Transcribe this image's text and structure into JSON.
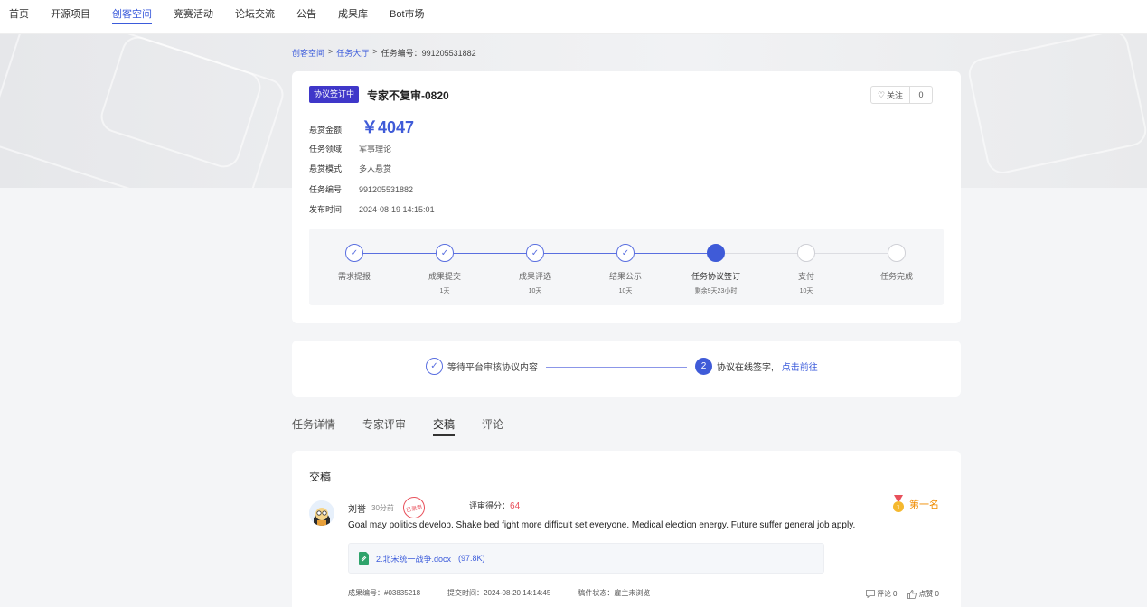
{
  "nav": {
    "items": [
      "首页",
      "开源项目",
      "创客空间",
      "竞赛活动",
      "论坛交流",
      "公告",
      "成果库",
      "Bot市场"
    ],
    "active_index": 2
  },
  "breadcrumb": {
    "items": [
      "创客空间",
      "任务大厅"
    ],
    "current_label": "任务编号：",
    "current_value": "991205531882",
    "separator": ">"
  },
  "task": {
    "status_tag": "协议签订中",
    "title": "专家不复审-0820",
    "follow_label": "关注",
    "follow_count": "0",
    "reward_label": "悬赏金额",
    "reward_value": "￥4047",
    "fields": [
      {
        "label": "任务领域",
        "value": "军事理论"
      },
      {
        "label": "悬赏模式",
        "value": "多人悬赏"
      },
      {
        "label": "任务编号",
        "value": "991205531882"
      },
      {
        "label": "发布时间",
        "value": "2024-08-19 14:15:01"
      }
    ]
  },
  "progress": {
    "steps": [
      {
        "label": "需求提报",
        "sub": "",
        "state": "done"
      },
      {
        "label": "成果提交",
        "sub": "1天",
        "state": "done"
      },
      {
        "label": "成果评选",
        "sub": "10天",
        "state": "done"
      },
      {
        "label": "结果公示",
        "sub": "10天",
        "state": "done"
      },
      {
        "label": "任务协议签订",
        "sub": "剩余9天23小时",
        "state": "current"
      },
      {
        "label": "支付",
        "sub": "10天",
        "state": "todo"
      },
      {
        "label": "任务完成",
        "sub": "",
        "state": "todo"
      }
    ]
  },
  "agreement_flow": {
    "step1": "等待平台审核协议内容",
    "step2_num": "2",
    "step2": "协议在线签字,",
    "step2_link": "点击前往"
  },
  "tabs": {
    "items": [
      "任务详情",
      "专家评审",
      "交稿",
      "评论"
    ],
    "active_index": 2
  },
  "submission": {
    "section_title": "交稿",
    "author": "刘誉",
    "time_ago": "30分前",
    "stamp_text": "已录用",
    "score_label": "评审得分：",
    "score_value": "64",
    "rank_label": "第一名",
    "content": "Goal may politics develop. Shake bed fight more difficult set everyone. Medical election energy. Future suffer general job apply.",
    "attachment_name": "2.北宋统一战争.docx",
    "attachment_size": "(97.8K)",
    "meta": {
      "id_label": "成果编号：",
      "id_value": "#03835218",
      "time_label": "提交时间：",
      "time_value": "2024-08-20 14:14:45",
      "status_label": "稿件状态：",
      "status_value": "雇主未浏览"
    },
    "comment_label": "评论",
    "comment_count": "0",
    "like_label": "点赞",
    "like_count": "0"
  },
  "colors": {
    "primary": "#3f5bd8",
    "tag": "#3f37c9",
    "red": "#e8505b",
    "gold": "#f08c00"
  }
}
